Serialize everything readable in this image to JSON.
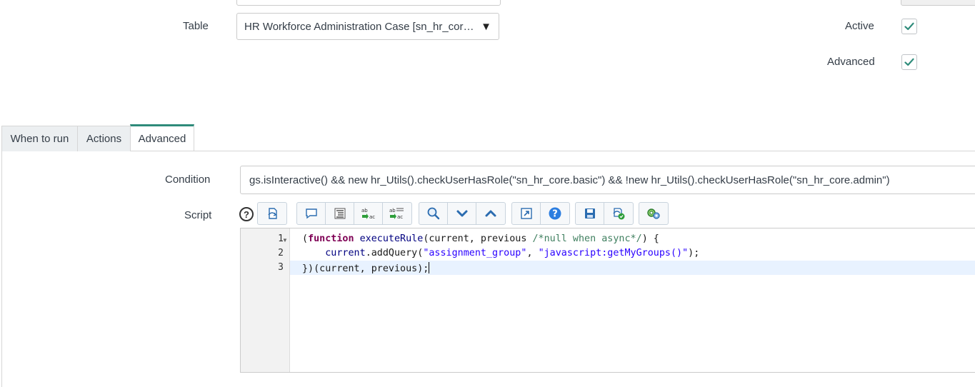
{
  "form": {
    "table_label": "Table",
    "table_value": "HR Workforce Administration Case [sn_hr_cor…",
    "active_label": "Active",
    "active_checked": true,
    "advanced_label": "Advanced",
    "advanced_checked": true
  },
  "tabs": [
    {
      "label": "When to run",
      "active": false
    },
    {
      "label": "Actions",
      "active": false
    },
    {
      "label": "Advanced",
      "active": true
    }
  ],
  "advanced": {
    "condition_label": "Condition",
    "condition_value": "gs.isInteractive() && new hr_Utils().checkUserHasRole(\"sn_hr_core.basic\") && !new hr_Utils().checkUserHasRole(\"sn_hr_core.admin\")",
    "script_label": "Script",
    "help_glyph": "?",
    "toolbar_icons": [
      "script-include-icon",
      "comment-icon",
      "format-code-icon",
      "replace-icon",
      "replace-all-icon",
      "search-icon",
      "next-icon",
      "previous-icon",
      "fullscreen-icon",
      "help-icon",
      "save-icon",
      "validate-icon",
      "debug-icon"
    ]
  },
  "script": {
    "line_numbers": [
      "1",
      "2",
      "3"
    ],
    "line1": {
      "open": "(",
      "kw": "function",
      "sp": " ",
      "fn": "executeRule",
      "args": "(current, previous ",
      "comment": "/*null when async*/",
      "end": ") {"
    },
    "line2": {
      "indent": "    ",
      "obj": "current",
      "call": ".addQuery(",
      "s1": "\"assignment_group\"",
      "sep": ", ",
      "s2": "\"javascript:getMyGroups()\"",
      "end": ");"
    },
    "line3": "})(current, previous);"
  },
  "colors": {
    "check": "#2e8b7a",
    "tab_accent": "#2e8b7a"
  }
}
